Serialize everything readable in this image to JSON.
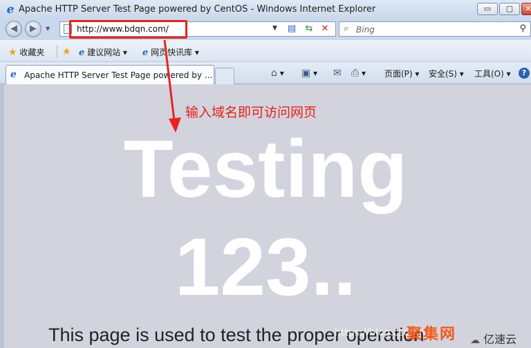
{
  "window": {
    "title": "Apache HTTP Server Test Page powered by CentOS - Windows Internet Explorer",
    "controls": {
      "minimize": "▭",
      "maximize": "▢",
      "close": "✕"
    }
  },
  "address": {
    "url": "http://www.bdqn.com/",
    "search_placeholder": "Bing"
  },
  "favorites": {
    "label": "收藏夹",
    "items": [
      {
        "label": "建议网站 ▾"
      },
      {
        "label": "网页快讯库 ▾"
      }
    ]
  },
  "tabs": [
    {
      "label": "Apache HTTP Server Test Page powered by ..."
    }
  ],
  "command_bar": {
    "page": "页面(P) ▾",
    "safety": "安全(S) ▾",
    "tools": "工具(O) ▾",
    "help": "?"
  },
  "annotation": {
    "text": "输入域名即可访问网页",
    "color": "#e32219"
  },
  "page": {
    "heading_line1": "Testing",
    "heading_line2": "123..",
    "body_text": "This page is used to test the proper operation",
    "background": "#d3d3de"
  },
  "watermarks": {
    "blog": "https://blog.csdn.net",
    "brand": "聚集网",
    "site": "亿速云"
  }
}
